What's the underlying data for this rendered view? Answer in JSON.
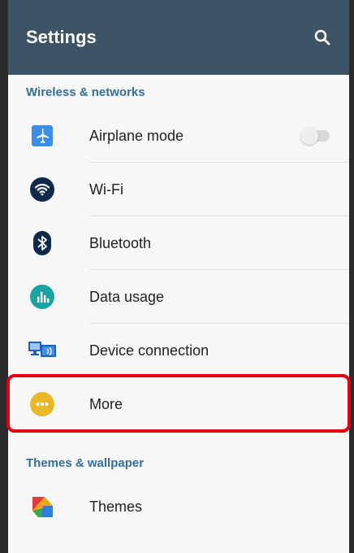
{
  "appbar": {
    "title": "Settings",
    "search_icon": "search-icon",
    "background": "#3d5467"
  },
  "sections": [
    {
      "header": "Wireless & networks",
      "items": [
        {
          "label": "Airplane mode",
          "icon": "airplane-icon",
          "toggle": false
        },
        {
          "label": "Wi-Fi",
          "icon": "wifi-icon"
        },
        {
          "label": "Bluetooth",
          "icon": "bluetooth-icon"
        },
        {
          "label": "Data usage",
          "icon": "data-usage-icon"
        },
        {
          "label": "Device connection",
          "icon": "device-connection-icon"
        },
        {
          "label": "More",
          "icon": "more-icon",
          "highlighted": true
        }
      ]
    },
    {
      "header": "Themes & wallpaper",
      "items": [
        {
          "label": "Themes",
          "icon": "themes-icon"
        }
      ]
    }
  ],
  "colors": {
    "section_header": "#2f6f9a",
    "highlight_border": "#e2000f"
  }
}
